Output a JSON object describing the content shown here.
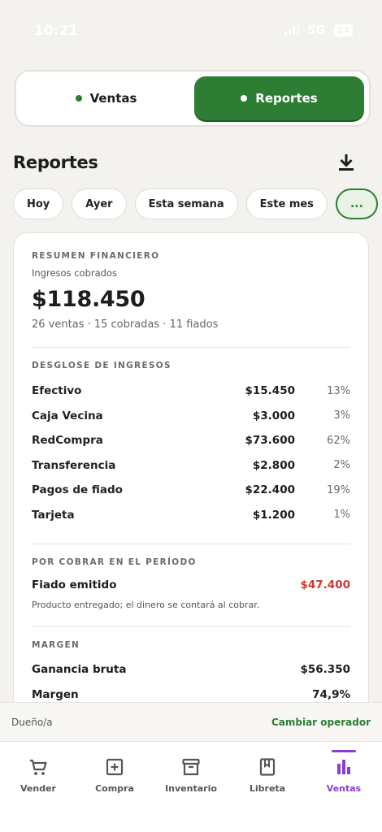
{
  "status_bar": {
    "time": "10:21",
    "network": "5G",
    "battery": "24"
  },
  "segmented": {
    "ventas_label": "Ventas",
    "reportes_label": "Reportes"
  },
  "header": {
    "title": "Reportes"
  },
  "chips": [
    "Hoy",
    "Ayer",
    "Esta semana",
    "Este mes",
    "..."
  ],
  "resumen": {
    "label": "RESUMEN FINANCIERO",
    "sub": "Ingresos cobrados",
    "total": "$118.450",
    "meta": "26 ventas · 15 cobradas · 11 fiados"
  },
  "desglose": {
    "label": "DESGLOSE DE INGRESOS",
    "rows": [
      {
        "name": "Efectivo",
        "amount": "$15.450",
        "pct": "13%"
      },
      {
        "name": "Caja Vecina",
        "amount": "$3.000",
        "pct": "3%"
      },
      {
        "name": "RedCompra",
        "amount": "$73.600",
        "pct": "62%"
      },
      {
        "name": "Transferencia",
        "amount": "$2.800",
        "pct": "2%"
      },
      {
        "name": "Pagos de fiado",
        "amount": "$22.400",
        "pct": "19%"
      },
      {
        "name": "Tarjeta",
        "amount": "$1.200",
        "pct": "1%"
      }
    ]
  },
  "por_cobrar": {
    "label": "POR COBRAR EN EL PERÍODO",
    "name": "Fiado emitido",
    "amount": "$47.400",
    "note": "Producto entregado; el dinero se contará al cobrar."
  },
  "margen": {
    "label": "MARGEN",
    "rows": [
      {
        "name": "Ganancia bruta",
        "value": "$56.350"
      },
      {
        "name": "Margen",
        "value": "74,9%"
      }
    ]
  },
  "operator": {
    "role": "Dueño/a",
    "change_label": "Cambiar operador"
  },
  "tabbar": {
    "tabs": [
      {
        "label": "Vender",
        "icon": "cart-icon"
      },
      {
        "label": "Compra",
        "icon": "plus-square-icon"
      },
      {
        "label": "Inventario",
        "icon": "archive-box-icon"
      },
      {
        "label": "Libreta",
        "icon": "book-icon"
      },
      {
        "label": "Ventas",
        "icon": "bar-chart-icon"
      }
    ],
    "active": "Ventas"
  },
  "colors": {
    "brand_green": "#2d7d34",
    "accent_purple": "#8a3fd1",
    "negative_red": "#c83a33",
    "background": "#f4f2ee"
  }
}
